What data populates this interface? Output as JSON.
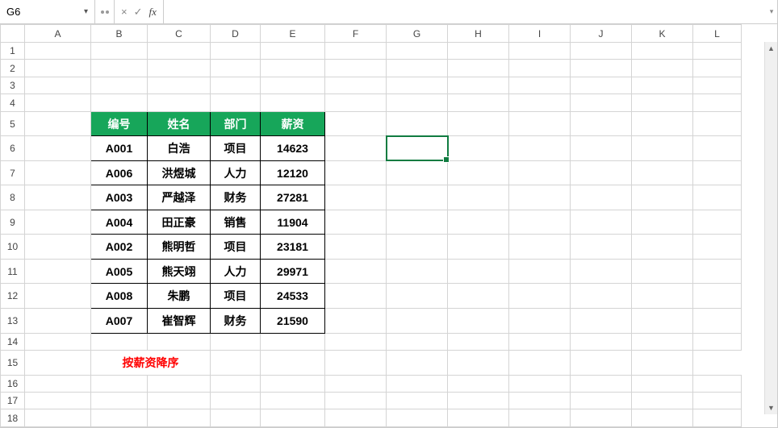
{
  "formula_bar": {
    "name_box": "G6",
    "cancel": "×",
    "confirm": "✓",
    "fx": "fx",
    "value": "",
    "dropdown": "▾"
  },
  "columns": [
    "A",
    "B",
    "C",
    "D",
    "E",
    "F",
    "G",
    "H",
    "I",
    "J",
    "K",
    "L"
  ],
  "rows": [
    "1",
    "2",
    "3",
    "4",
    "5",
    "6",
    "7",
    "8",
    "9",
    "10",
    "11",
    "12",
    "13",
    "14",
    "15",
    "16",
    "17",
    "18"
  ],
  "active_cell": "G6",
  "table": {
    "headers": {
      "b": "编号",
      "c": "姓名",
      "d": "部门",
      "e": "薪资"
    },
    "rows": [
      {
        "b": "A001",
        "c": "白浩",
        "d": "项目",
        "e": "14623"
      },
      {
        "b": "A006",
        "c": "洪煜城",
        "d": "人力",
        "e": "12120"
      },
      {
        "b": "A003",
        "c": "严越泽",
        "d": "财务",
        "e": "27281"
      },
      {
        "b": "A004",
        "c": "田正豪",
        "d": "销售",
        "e": "11904"
      },
      {
        "b": "A002",
        "c": "熊明哲",
        "d": "项目",
        "e": "23181"
      },
      {
        "b": "A005",
        "c": "熊天翊",
        "d": "人力",
        "e": "29971"
      },
      {
        "b": "A008",
        "c": "朱鹏",
        "d": "项目",
        "e": "24533"
      },
      {
        "b": "A007",
        "c": "崔智辉",
        "d": "财务",
        "e": "21590"
      }
    ]
  },
  "note": "按薪资降序",
  "chart_data": {
    "type": "table",
    "title": "",
    "columns": [
      "编号",
      "姓名",
      "部门",
      "薪资"
    ],
    "rows": [
      [
        "A001",
        "白浩",
        "项目",
        14623
      ],
      [
        "A006",
        "洪煜城",
        "人力",
        12120
      ],
      [
        "A003",
        "严越泽",
        "财务",
        27281
      ],
      [
        "A004",
        "田正豪",
        "销售",
        11904
      ],
      [
        "A002",
        "熊明哲",
        "项目",
        23181
      ],
      [
        "A005",
        "熊天翊",
        "人力",
        29971
      ],
      [
        "A008",
        "朱鹏",
        "项目",
        24533
      ],
      [
        "A007",
        "崔智辉",
        "财务",
        21590
      ]
    ],
    "note": "按薪资降序"
  }
}
